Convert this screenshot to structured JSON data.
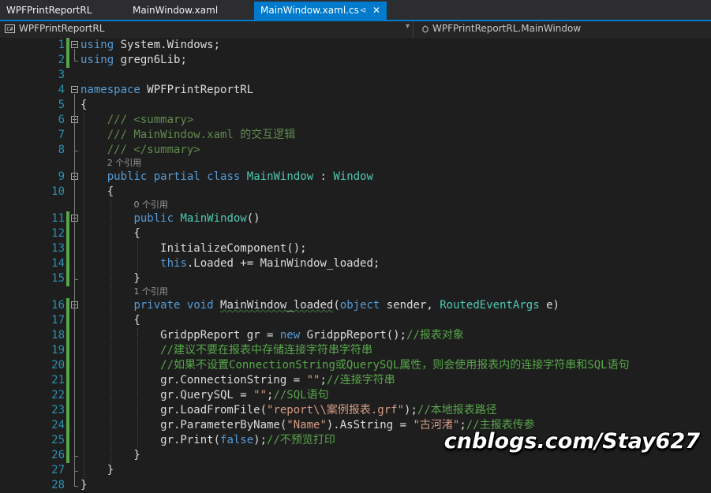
{
  "tabs": [
    {
      "label": "WPFPrintReportRL",
      "active": false
    },
    {
      "label": "MainWindow.xaml",
      "active": false
    },
    {
      "label": "MainWindow.xaml.cs",
      "active": true,
      "pin": "⊲",
      "close": "✕"
    }
  ],
  "nav": {
    "project_badge": "C#",
    "project": "WPFPrintReportRL",
    "dropdown": "▾",
    "member": "WPFPrintReportRL.MainWindow"
  },
  "code_lines": [
    {
      "n": "1",
      "segs": [
        {
          "c": "kw",
          "t": "using"
        },
        {
          "t": " System.Windows;"
        }
      ]
    },
    {
      "n": "2",
      "segs": [
        {
          "c": "kw",
          "t": "using"
        },
        {
          "t": " gregn6Lib;"
        }
      ]
    },
    {
      "n": "3",
      "segs": []
    },
    {
      "n": "4",
      "segs": [
        {
          "c": "kw",
          "t": "namespace"
        },
        {
          "t": " WPFPrintReportRL"
        }
      ]
    },
    {
      "n": "5",
      "segs": [
        {
          "t": "{"
        }
      ]
    },
    {
      "n": "6",
      "segs": [
        {
          "t": "    "
        },
        {
          "c": "dc",
          "t": "/// <summary>"
        }
      ]
    },
    {
      "n": "7",
      "segs": [
        {
          "t": "    "
        },
        {
          "c": "dc",
          "t": "/// MainWindow.xaml 的交互逻辑"
        }
      ]
    },
    {
      "n": "8",
      "segs": [
        {
          "t": "    "
        },
        {
          "c": "dc",
          "t": "/// </summary>"
        }
      ]
    },
    {
      "n": "9",
      "segs": [
        {
          "t": "    "
        },
        {
          "c": "kw",
          "t": "public"
        },
        {
          "t": " "
        },
        {
          "c": "kw",
          "t": "partial"
        },
        {
          "t": " "
        },
        {
          "c": "kw",
          "t": "class"
        },
        {
          "t": " "
        },
        {
          "c": "ty",
          "t": "MainWindow"
        },
        {
          "t": " : "
        },
        {
          "c": "ty",
          "t": "Window"
        }
      ]
    },
    {
      "n": "10",
      "segs": [
        {
          "t": "    {"
        }
      ]
    },
    {
      "n": "11",
      "segs": [
        {
          "t": "        "
        },
        {
          "c": "kw",
          "t": "public"
        },
        {
          "t": " "
        },
        {
          "c": "ty",
          "t": "MainWindow"
        },
        {
          "t": "()"
        }
      ]
    },
    {
      "n": "12",
      "segs": [
        {
          "t": "        {"
        }
      ]
    },
    {
      "n": "13",
      "segs": [
        {
          "t": "            InitializeComponent();"
        }
      ]
    },
    {
      "n": "14",
      "segs": [
        {
          "t": "            "
        },
        {
          "c": "kw",
          "t": "this"
        },
        {
          "t": ".Loaded += MainWindow_loaded;"
        }
      ]
    },
    {
      "n": "15",
      "segs": [
        {
          "t": "        }"
        }
      ]
    },
    {
      "n": "16",
      "segs": [
        {
          "t": "        "
        },
        {
          "c": "kw",
          "t": "private"
        },
        {
          "t": " "
        },
        {
          "c": "kw",
          "t": "void"
        },
        {
          "t": " "
        },
        {
          "c": "sq",
          "t": "MainWindow_loaded"
        },
        {
          "t": "("
        },
        {
          "c": "kw",
          "t": "object"
        },
        {
          "t": " sender, "
        },
        {
          "c": "ty",
          "t": "RoutedEventArgs"
        },
        {
          "t": " e)"
        }
      ]
    },
    {
      "n": "17",
      "segs": [
        {
          "t": "        {"
        }
      ]
    },
    {
      "n": "18",
      "segs": [
        {
          "t": "            GridppReport gr = "
        },
        {
          "c": "kw",
          "t": "new"
        },
        {
          "t": " GridppReport();"
        },
        {
          "c": "cm",
          "t": "//报表对象"
        }
      ]
    },
    {
      "n": "19",
      "segs": [
        {
          "t": "            "
        },
        {
          "c": "cm",
          "t": "//建议不要在报表中存储连接字符串字符串"
        }
      ]
    },
    {
      "n": "20",
      "segs": [
        {
          "t": "            "
        },
        {
          "c": "cm",
          "t": "//如果不设置ConnectionString或QuerySQL属性，则会使用报表内的连接字符串和SQL语句"
        }
      ]
    },
    {
      "n": "21",
      "segs": [
        {
          "t": "            gr.ConnectionString = "
        },
        {
          "c": "st",
          "t": "\"\""
        },
        {
          "t": ";"
        },
        {
          "c": "cm",
          "t": "//连接字符串"
        }
      ]
    },
    {
      "n": "22",
      "segs": [
        {
          "t": "            gr.QuerySQL = "
        },
        {
          "c": "st",
          "t": "\"\""
        },
        {
          "t": ";"
        },
        {
          "c": "cm",
          "t": "//SQL语句"
        }
      ]
    },
    {
      "n": "23",
      "segs": [
        {
          "t": "            gr.LoadFromFile("
        },
        {
          "c": "st",
          "t": "\"report\\\\案例报表.grf\""
        },
        {
          "t": ");"
        },
        {
          "c": "cm",
          "t": "//本地报表路径"
        }
      ]
    },
    {
      "n": "24",
      "segs": [
        {
          "t": "            gr.ParameterByName("
        },
        {
          "c": "st",
          "t": "\"Name\""
        },
        {
          "t": ").AsString = "
        },
        {
          "c": "st",
          "t": "\"古河渚\""
        },
        {
          "t": ";"
        },
        {
          "c": "cm",
          "t": "//主报表传参"
        }
      ]
    },
    {
      "n": "25",
      "segs": [
        {
          "t": "            gr.Print("
        },
        {
          "c": "kw",
          "t": "false"
        },
        {
          "t": ");"
        },
        {
          "c": "cm",
          "t": "//不预览打印"
        }
      ]
    },
    {
      "n": "26",
      "segs": [
        {
          "t": "        }"
        }
      ]
    },
    {
      "n": "27",
      "segs": [
        {
          "t": "    }"
        }
      ]
    },
    {
      "n": "28",
      "segs": [
        {
          "t": "}"
        }
      ]
    }
  ],
  "codelens": [
    {
      "after": "8",
      "text": "2 个引用"
    },
    {
      "after": "10",
      "text": "0 个引用"
    },
    {
      "after": "15",
      "text": "1 个引用"
    }
  ],
  "watermark": "cnblogs.com/Stay627"
}
